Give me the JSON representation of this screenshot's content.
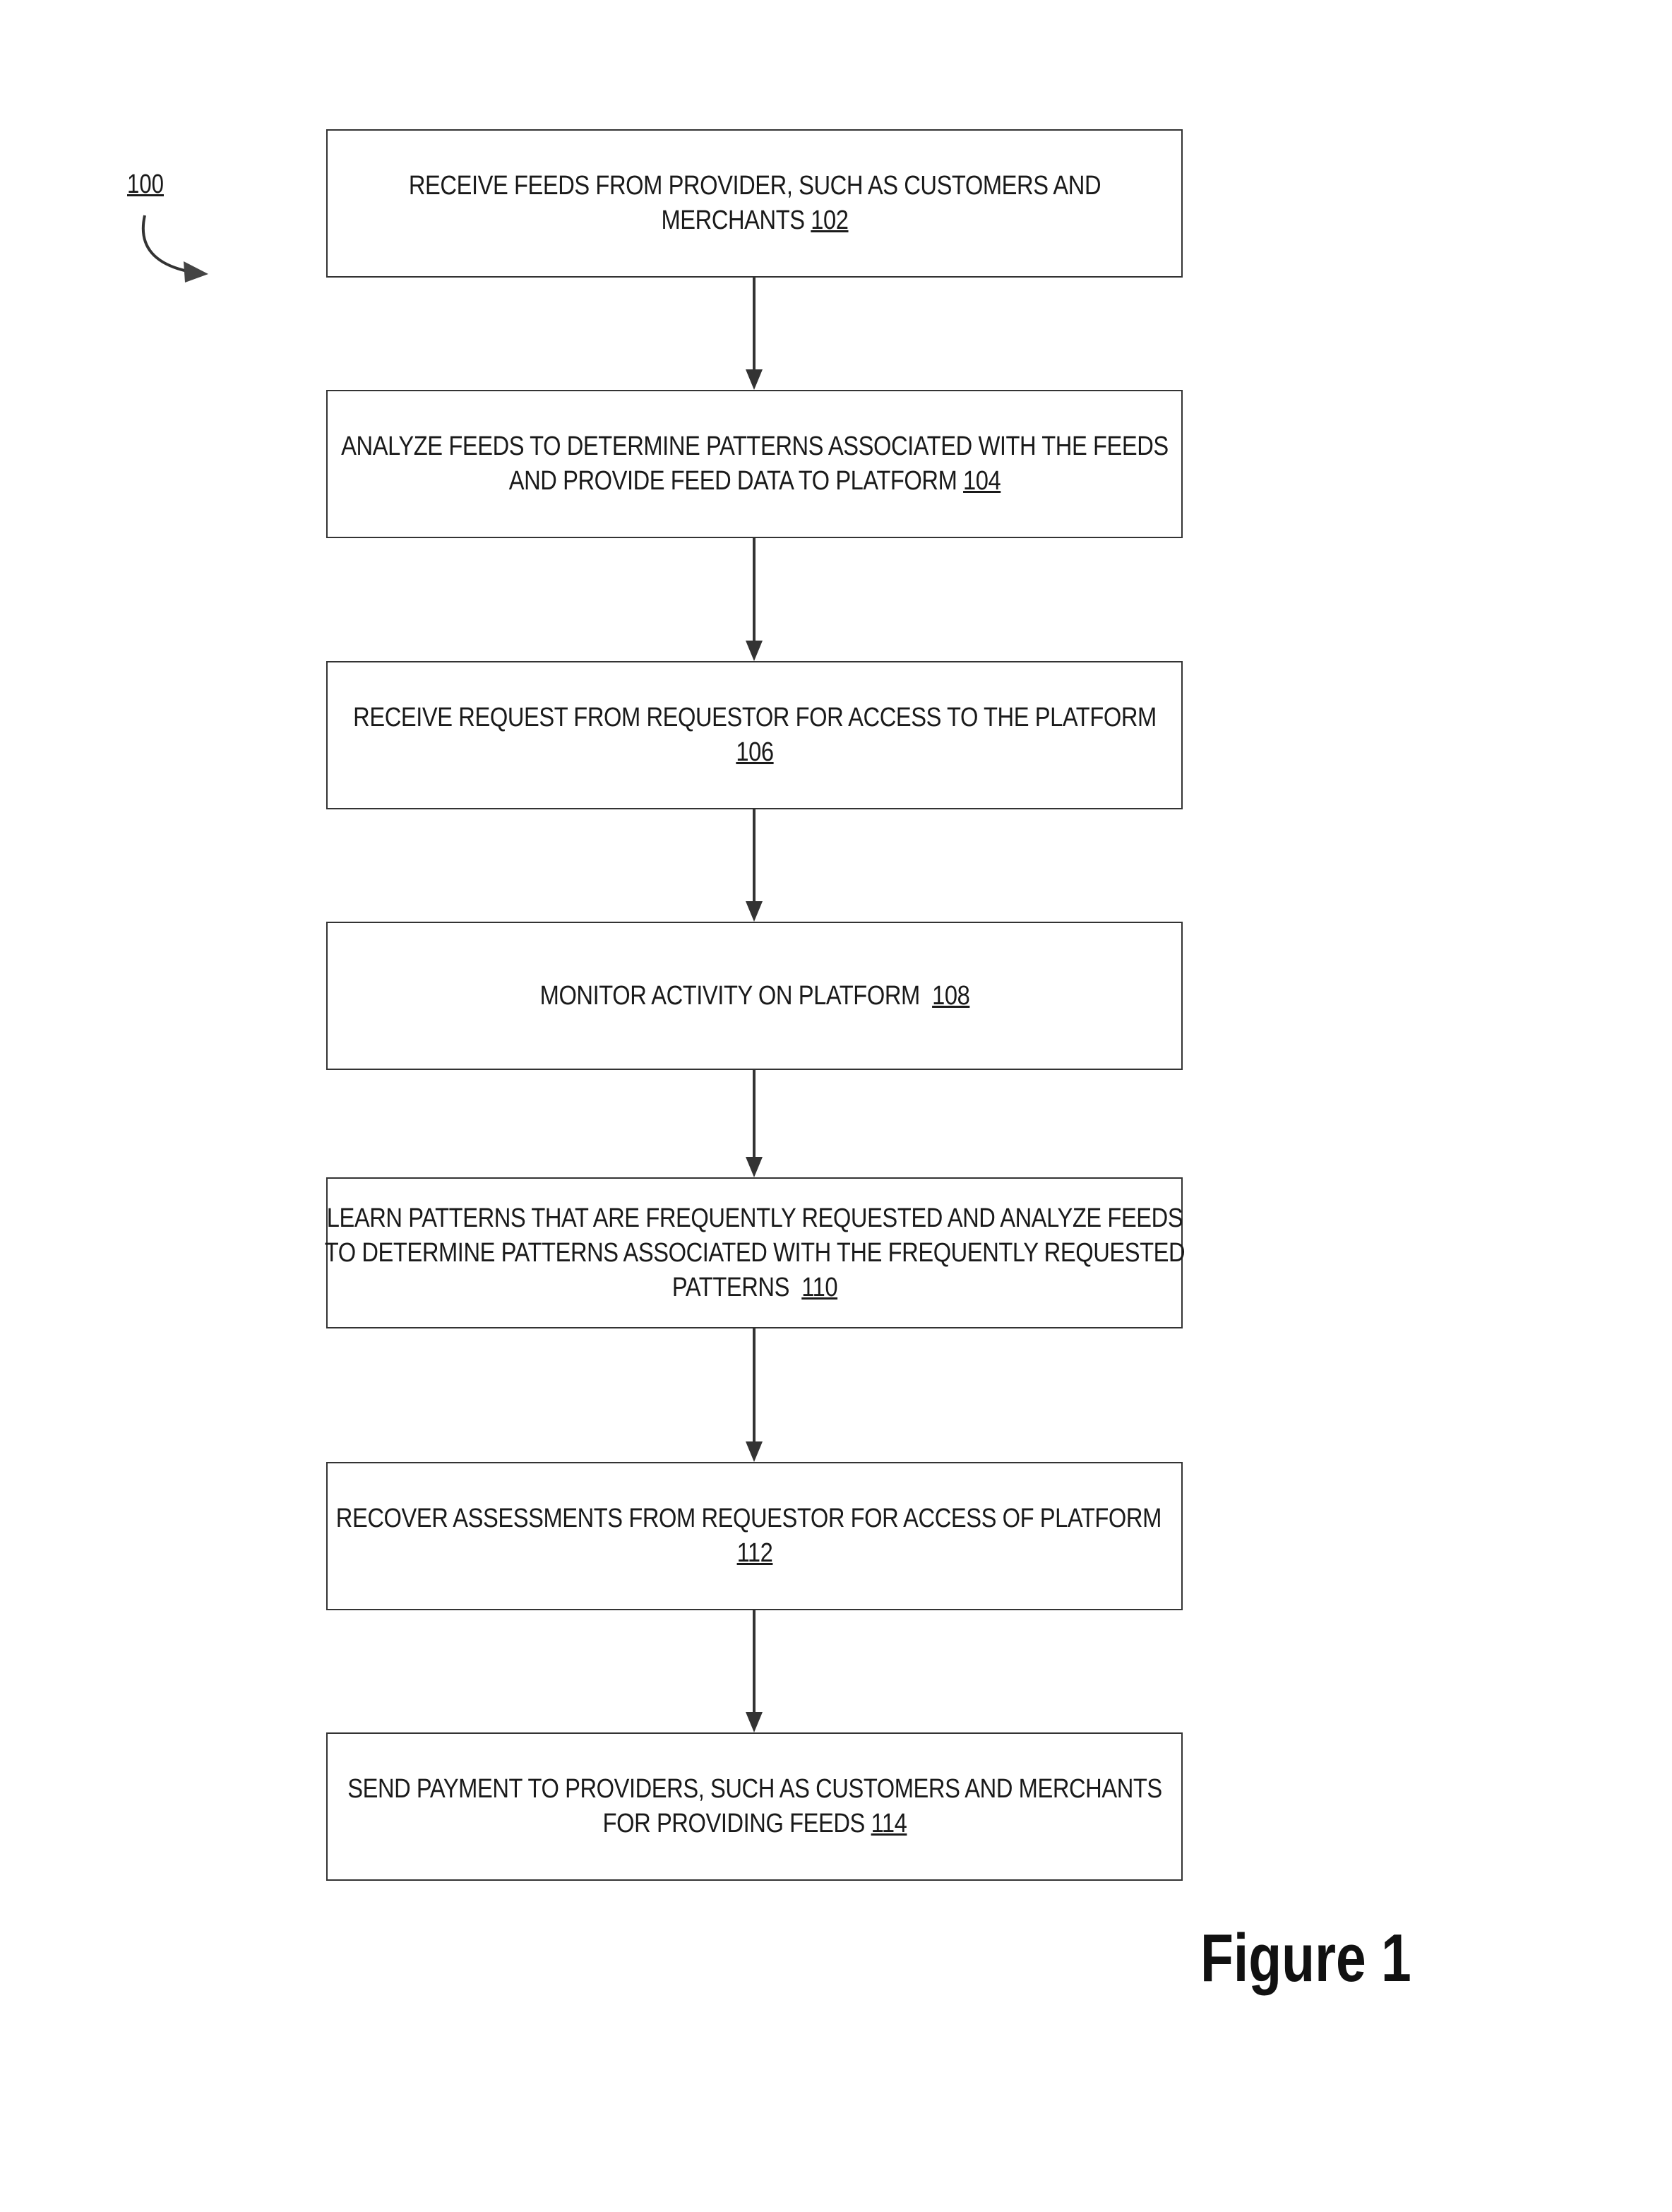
{
  "diagram": {
    "reference_label": "100",
    "figure_label": "Figure 1",
    "steps": [
      {
        "text": "RECEIVE FEEDS FROM PROVIDER, SUCH AS CUSTOMERS AND MERCHANTS",
        "number": "102"
      },
      {
        "text": "ANALYZE FEEDS TO DETERMINE PATTERNS ASSOCIATED WITH THE FEEDS AND PROVIDE FEED DATA TO PLATFORM",
        "number": "104"
      },
      {
        "text": "RECEIVE REQUEST FROM REQUESTOR FOR ACCESS TO THE PLATFORM",
        "number": "106"
      },
      {
        "text": "MONITOR ACTIVITY ON PLATFORM",
        "number": "108"
      },
      {
        "text": "LEARN PATTERNS THAT ARE FREQUENTLY REQUESTED AND ANALYZE FEEDS TO DETERMINE PATTERNS ASSOCIATED WITH THE FREQUENTLY REQUESTED PATTERNS",
        "number": "110"
      },
      {
        "text": "RECOVER ASSESSMENTS FROM REQUESTOR FOR ACCESS OF PLATFORM",
        "number": "112"
      },
      {
        "text": "SEND PAYMENT TO PROVIDERS, SUCH AS CUSTOMERS AND MERCHANTS FOR PROVIDING FEEDS",
        "number": "114"
      }
    ]
  }
}
